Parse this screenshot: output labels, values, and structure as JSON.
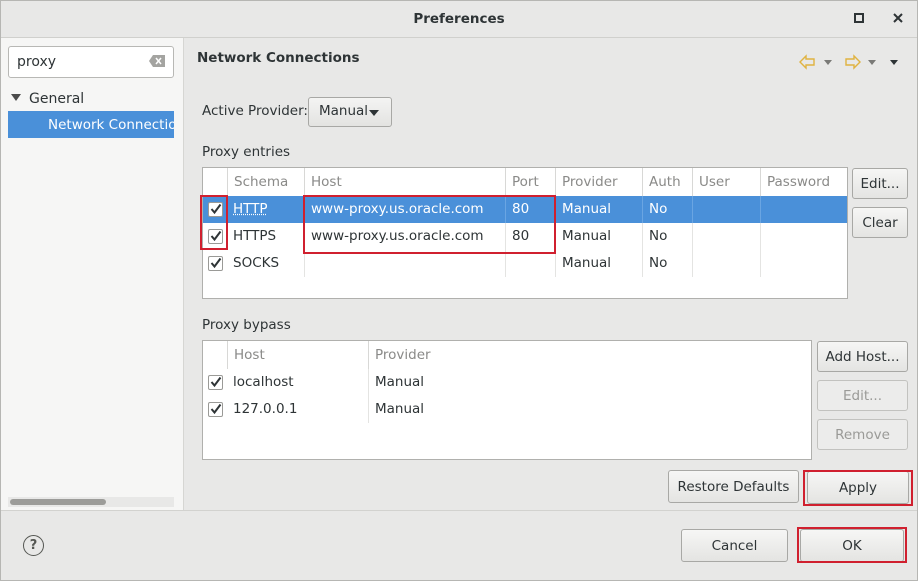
{
  "window": {
    "title": "Preferences",
    "minimize_icon": "square-icon",
    "close_icon": "x-icon"
  },
  "sidebar": {
    "search_value": "proxy",
    "tree": {
      "group_label": "General",
      "selected_item": "Network Connections"
    }
  },
  "page": {
    "title": "Network Connections",
    "active_provider_label": "Active Provider:",
    "active_provider_value": "Manual",
    "proxy_entries": {
      "section_label": "Proxy entries",
      "columns": [
        "Schema",
        "Host",
        "Port",
        "Provider",
        "Auth",
        "User",
        "Password"
      ],
      "rows": [
        {
          "checked": true,
          "schema": "HTTP",
          "host": "www-proxy.us.oracle.com",
          "port": "80",
          "provider": "Manual",
          "auth": "No",
          "user": "",
          "password": ""
        },
        {
          "checked": true,
          "schema": "HTTPS",
          "host": "www-proxy.us.oracle.com",
          "port": "80",
          "provider": "Manual",
          "auth": "No",
          "user": "",
          "password": ""
        },
        {
          "checked": true,
          "schema": "SOCKS",
          "host": "",
          "port": "",
          "provider": "Manual",
          "auth": "No",
          "user": "",
          "password": ""
        }
      ],
      "edit_button": "Edit...",
      "clear_button": "Clear"
    },
    "proxy_bypass": {
      "section_label": "Proxy bypass",
      "columns": [
        "Host",
        "Provider"
      ],
      "rows": [
        {
          "checked": true,
          "host": "localhost",
          "provider": "Manual"
        },
        {
          "checked": true,
          "host": "127.0.0.1",
          "provider": "Manual"
        }
      ],
      "add_host_button": "Add Host...",
      "edit_button": "Edit...",
      "remove_button": "Remove"
    },
    "restore_defaults_button": "Restore Defaults",
    "apply_button": "Apply"
  },
  "footer": {
    "help_icon": "?",
    "cancel_button": "Cancel",
    "ok_button": "OK"
  },
  "colors": {
    "selection": "#4a90d9",
    "highlight_box": "#d0202f"
  }
}
